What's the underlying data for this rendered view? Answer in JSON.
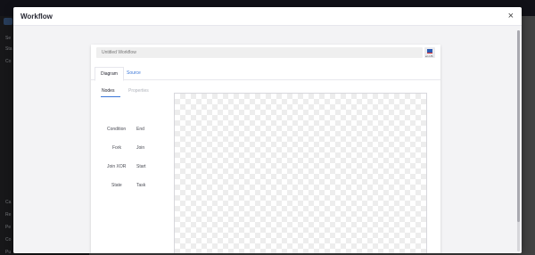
{
  "modal": {
    "title": "Workflow",
    "close_glyph": "×"
  },
  "editor": {
    "name_placeholder": "Untitled Workflow",
    "locale_label": "en-US",
    "tabs": [
      {
        "label": "Diagram"
      },
      {
        "label": "Source"
      }
    ],
    "subtabs": [
      {
        "label": "Nodes"
      },
      {
        "label": "Properties"
      }
    ],
    "nodes": [
      "Condition",
      "End",
      "Fork",
      "Join",
      "Join XOR",
      "Start",
      "State",
      "Task"
    ]
  },
  "background": {
    "sidebar_items": [
      "Se",
      "Sta",
      "Co",
      "Ca",
      "Re",
      "Pe",
      "Co",
      "Pu"
    ]
  },
  "colors": {
    "accent": "#3b77d8",
    "overlay_dim": "#6b6b6b"
  }
}
